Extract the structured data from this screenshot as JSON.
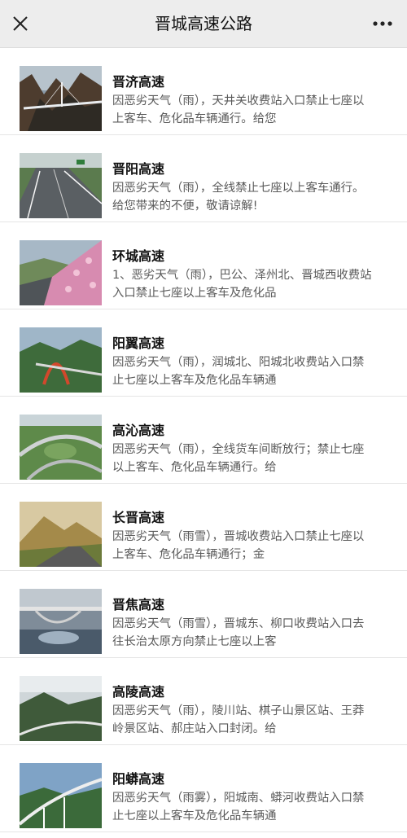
{
  "nav": {
    "title": "晋城高速公路",
    "close_icon": "close-icon",
    "more_icon": "more-icon"
  },
  "roads": [
    {
      "name": "晋济高速",
      "desc": "因恶劣天气（雨），天井关收费站入口禁止七座以上客车、危化品车辆通行。给您"
    },
    {
      "name": "晋阳高速",
      "desc": "因恶劣天气（雨），全线禁止七座以上客车通行。给您带来的不便，敬请谅解!"
    },
    {
      "name": "环城高速",
      "desc": "1、恶劣天气（雨），巴公、泽州北、晋城西收费站入口禁止七座以上客车及危化品"
    },
    {
      "name": "阳翼高速",
      "desc": "因恶劣天气（雨），润城北、阳城北收费站入口禁止七座以上客车及危化品车辆通"
    },
    {
      "name": "高沁高速",
      "desc": "因恶劣天气（雨），全线货车间断放行；禁止七座以上客车、危化品车辆通行。给"
    },
    {
      "name": "长晋高速",
      "desc": "因恶劣天气（雨雪），晋城收费站入口禁止七座以上客车、危化品车辆通行；金"
    },
    {
      "name": "晋焦高速",
      "desc": "因恶劣天气（雨雪），晋城东、柳口收费站入口去往长治太原方向禁止七座以上客"
    },
    {
      "name": "高陵高速",
      "desc": "因恶劣天气（雨），陵川站、棋子山景区站、王莽岭景区站、郝庄站入口封闭。给"
    },
    {
      "name": "阳蟒高速",
      "desc": "因恶劣天气（雨雾），阳城南、蟒河收费站入口禁止七座以上客车及危化品车辆通"
    }
  ]
}
